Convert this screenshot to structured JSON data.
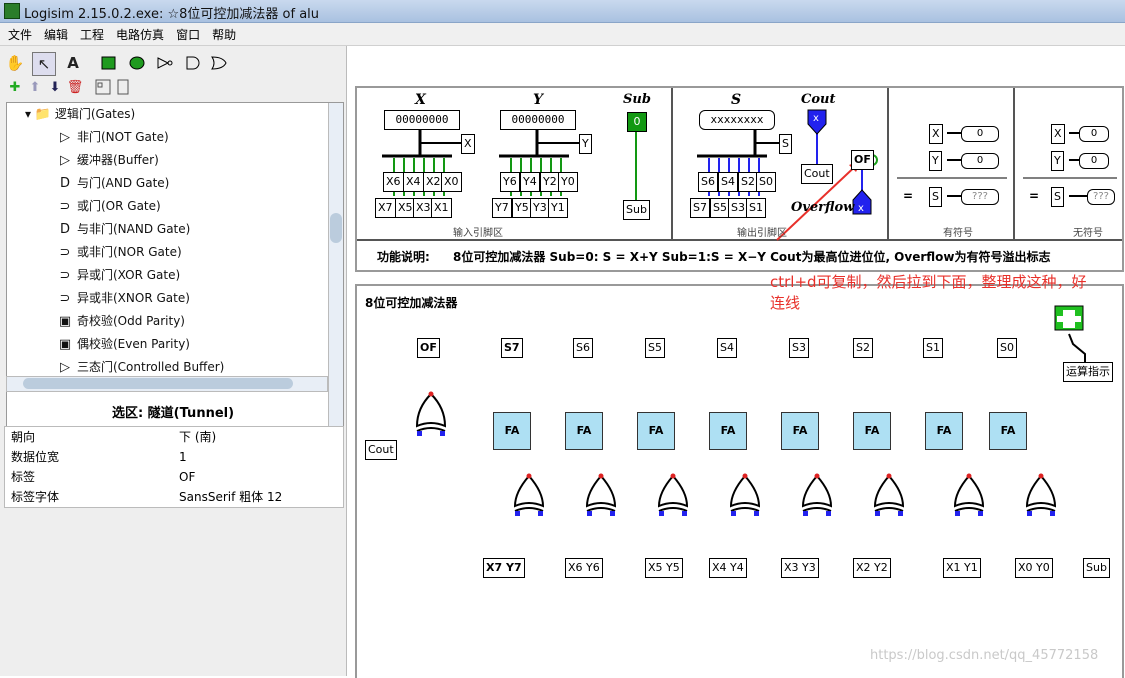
{
  "window": {
    "title": "Logisim 2.15.0.2.exe: ☆8位可控加减法器 of alu"
  },
  "menu": [
    "文件",
    "编辑",
    "工程",
    "电路仿真",
    "窗口",
    "帮助"
  ],
  "toolbar": {
    "text_tool": "A",
    "tools": [
      "hand-icon",
      "arrow-icon",
      "text-icon",
      "input-pin-icon",
      "output-pin-icon",
      "not-gate-icon",
      "and-gate-icon",
      "or-gate-icon"
    ]
  },
  "tree": {
    "category": "逻辑门(Gates)",
    "items": [
      "非门(NOT Gate)",
      "缓冲器(Buffer)",
      "与门(AND Gate)",
      "或门(OR Gate)",
      "与非门(NAND Gate)",
      "或非门(NOR Gate)",
      "异或门(XOR Gate)",
      "异或非(XNOR Gate)",
      "奇校验(Odd Parity)",
      "偶校验(Even Parity)",
      "三态门(Controlled Buffer)"
    ]
  },
  "props": {
    "title": "选区: 隧道(Tunnel)",
    "rows": [
      {
        "k": "朝向",
        "v": "下 (南)"
      },
      {
        "k": "数据位宽",
        "v": "1"
      },
      {
        "k": "标签",
        "v": "OF"
      },
      {
        "k": "标签字体",
        "v": "SansSerif 粗体 12"
      }
    ]
  },
  "top": {
    "x_label": "X",
    "y_label": "Y",
    "sub_label": "Sub",
    "s_label": "S",
    "cout_label": "Cout",
    "overflow_label": "Overflow",
    "x_val": "00000000",
    "y_val": "00000000",
    "sub_val": "0",
    "s_val": "xxxxxxxx",
    "x_bits_row1": [
      "X6",
      "X4",
      "X2",
      "X0"
    ],
    "x_bits_row2": [
      "X7",
      "X5",
      "X3",
      "X1"
    ],
    "y_bits_row1": [
      "Y6",
      "Y4",
      "Y2",
      "Y0"
    ],
    "y_bits_row2": [
      "Y7",
      "Y5",
      "Y3",
      "Y1"
    ],
    "s_bits_row1": [
      "S6",
      "S4",
      "S2",
      "S0"
    ],
    "s_bits_row2": [
      "S7",
      "S5",
      "S3",
      "S1"
    ],
    "x_tunnel": "X",
    "y_tunnel": "Y",
    "s_tunnel": "S",
    "sub_tunnel": "Sub",
    "cout_tunnel": "Cout",
    "of_tunnel": "OF",
    "cout_pin": "x",
    "of_pin": "x",
    "input_area": "输入引脚区",
    "output_area": "输出引脚区",
    "signed_label": "有符号",
    "unsigned_label": "无符号",
    "eq": "=",
    "q": "???",
    "zero": "0",
    "desc_prefix": "功能说明:",
    "desc": "8位可控加减法器    Sub=0: S = X+Y   Sub=1:S = X−Y    Cout为最高位进位位,  Overflow为有符号溢出标志"
  },
  "bottom": {
    "title": "8位可控加减法器",
    "out_tunnels": [
      "OF",
      "S7",
      "S6",
      "S5",
      "S4",
      "S3",
      "S2",
      "S1",
      "S0"
    ],
    "fa": "FA",
    "cout": "Cout",
    "in_pairs": [
      [
        "X7",
        "Y7"
      ],
      [
        "X6",
        "Y6"
      ],
      [
        "X5",
        "Y5"
      ],
      [
        "X4",
        "Y4"
      ],
      [
        "X3",
        "Y3"
      ],
      [
        "X2",
        "Y2"
      ],
      [
        "X1",
        "Y1"
      ],
      [
        "X0",
        "Y0"
      ]
    ],
    "sub": "Sub",
    "hint": "运算指示"
  },
  "annotation": {
    "line1": "ctrl+d可复制，然后拉到下面，整理成这种，好",
    "line2": "连线"
  },
  "watermark": "https://blog.csdn.net/qq_45772158",
  "colors": {
    "wire_green": "#129812",
    "wire_blue": "#2222ee",
    "fa_fill": "#aee0f3",
    "note": "#e8302a"
  }
}
